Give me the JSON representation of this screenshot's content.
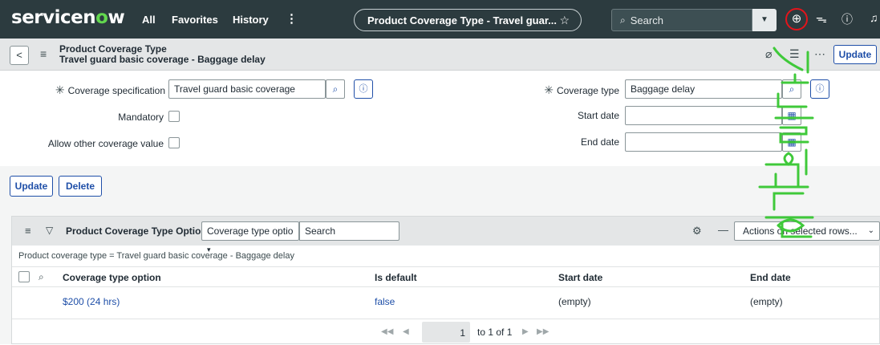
{
  "topnav": {
    "logo": "servicenow",
    "links": [
      "All",
      "Favorites",
      "History"
    ],
    "more": "⋮",
    "record_title": "Product Coverage Type - Travel guar...",
    "search_placeholder": "Search"
  },
  "form_header": {
    "table_name": "Product Coverage Type",
    "record_name": "Travel guard basic coverage - Baggage delay",
    "update_label": "Update"
  },
  "form": {
    "coverage_spec_label": "Coverage specification",
    "coverage_spec_value": "Travel guard basic coverage",
    "coverage_type_label": "Coverage type",
    "coverage_type_value": "Baggage delay",
    "mandatory_label": "Mandatory",
    "allow_other_label": "Allow other coverage value",
    "start_date_label": "Start date",
    "end_date_label": "End date",
    "mandatory_checked": false,
    "allow_other_checked": false
  },
  "buttons": {
    "update": "Update",
    "delete": "Delete"
  },
  "related_list": {
    "title": "Product Coverage Type Options",
    "field_select": "Coverage type optio",
    "search_placeholder": "Search",
    "actions": "Actions on selected rows...",
    "breadcrumb": "Product coverage type = Travel guard basic coverage - Baggage delay",
    "columns": [
      "Coverage type option",
      "Is default",
      "Start date",
      "End date"
    ],
    "rows": [
      {
        "option": "$200 (24 hrs)",
        "is_default": "false",
        "start": "(empty)",
        "end": "(empty)"
      }
    ],
    "pagination": "1 to 1 of 1",
    "page_number": "1"
  },
  "overlay_text": "오늘의 운세",
  "colors": {
    "nav_bg": "#2c3b3f",
    "accent": "#1f4fa8",
    "logo_green": "#62d84e",
    "alert_red": "#e3141b",
    "overlay_green": "#3fc93a"
  }
}
